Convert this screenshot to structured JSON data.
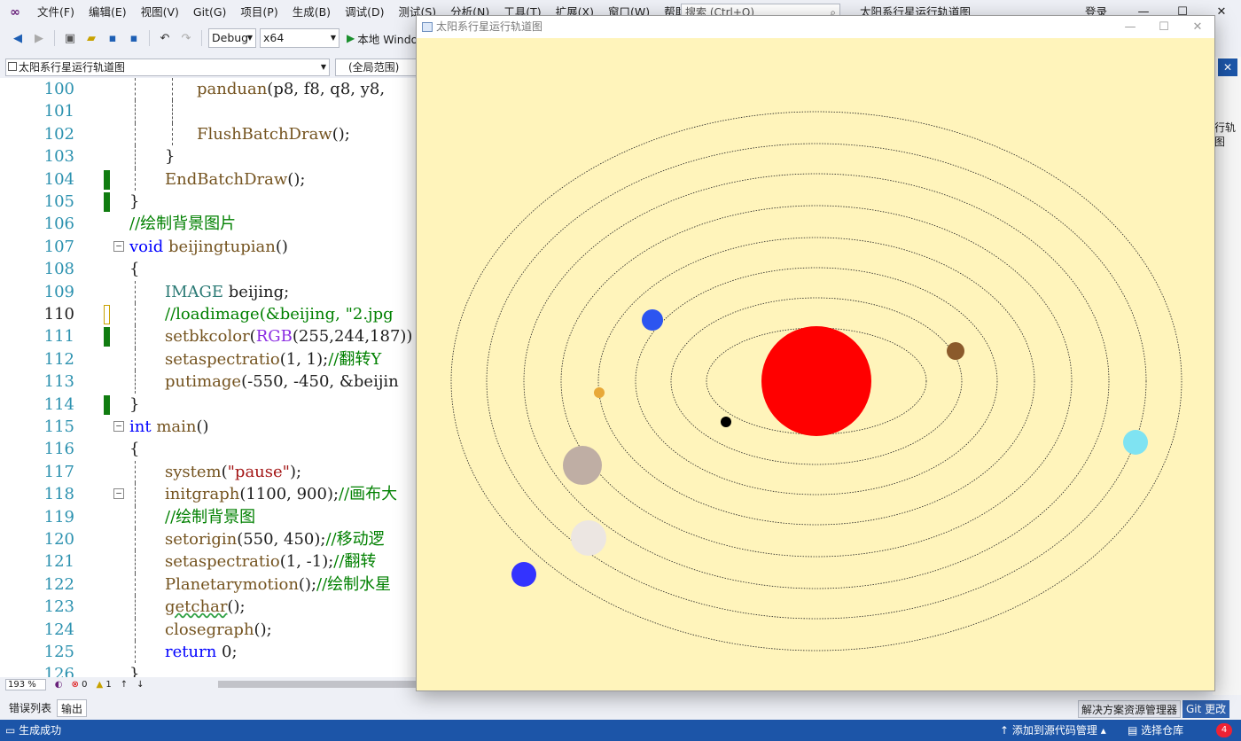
{
  "menubar": {
    "items": [
      "文件(F)",
      "编辑(E)",
      "视图(V)",
      "Git(G)",
      "项目(P)",
      "生成(B)",
      "调试(D)",
      "测试(S)",
      "分析(N)",
      "工具(T)",
      "扩展(X)",
      "窗口(W)",
      "帮助(H)"
    ],
    "search_placeholder": "搜索 (Ctrl+Q)",
    "solution_title": "太阳系行星运行轨道图",
    "login": "登录"
  },
  "toolbar": {
    "config": "Debug",
    "platform": "x64",
    "run_label": "本地 Windo"
  },
  "navbar": {
    "project": "太阳系行星运行轨道图",
    "scope": "(全局范围)"
  },
  "editor": {
    "lines": [
      {
        "n": "100",
        "text": "panduan(p8, f8, q8, y8,"
      },
      {
        "n": "101",
        "text": ""
      },
      {
        "n": "102",
        "text": "FlushBatchDraw();"
      },
      {
        "n": "103",
        "text": "}"
      },
      {
        "n": "104",
        "text": "EndBatchDraw();"
      },
      {
        "n": "105",
        "text": "}"
      },
      {
        "n": "106",
        "text": "//绘制背景图片"
      },
      {
        "n": "107",
        "text": "void beijingtupian()"
      },
      {
        "n": "108",
        "text": "{"
      },
      {
        "n": "109",
        "text": "IMAGE beijing;"
      },
      {
        "n": "110",
        "text": "//loadimage(&beijing, \"2.jpg"
      },
      {
        "n": "111",
        "text": "setbkcolor(RGB(255,244,187))"
      },
      {
        "n": "112",
        "text": "setaspectratio(1, 1);//翻转Y"
      },
      {
        "n": "113",
        "text": "putimage(-550, -450, &beijin"
      },
      {
        "n": "114",
        "text": "}"
      },
      {
        "n": "115",
        "text": "int main()"
      },
      {
        "n": "116",
        "text": "{"
      },
      {
        "n": "117",
        "text": "system(\"pause\");"
      },
      {
        "n": "118",
        "text": "initgraph(1100, 900);//画布大"
      },
      {
        "n": "119",
        "text": "//绘制背景图"
      },
      {
        "n": "120",
        "text": "setorigin(550, 450);//移动逻"
      },
      {
        "n": "121",
        "text": "setaspectratio(1, -1);//翻转"
      },
      {
        "n": "122",
        "text": "Planetarymotion();//绘制水星"
      },
      {
        "n": "123",
        "text": "getchar();"
      },
      {
        "n": "124",
        "text": "closegraph();"
      },
      {
        "n": "125",
        "text": "return 0;"
      },
      {
        "n": "126",
        "text": "}"
      }
    ]
  },
  "editor_status": {
    "zoom": "193 %",
    "errors": "0",
    "warnings": "1"
  },
  "bottom_tabs": {
    "error_list": "错误列表",
    "output": "输出",
    "solution_explorer": "解决方案资源管理器",
    "git_changes": "Git 更改"
  },
  "statusbar": {
    "build": "生成成功",
    "add_source": "添加到源代码管理",
    "select_repo": "选择仓库",
    "notifications": "4"
  },
  "right_panel": {
    "text": "行轨图"
  },
  "app_window": {
    "title": "太阳系行星运行轨道图",
    "background": "#fff4bb",
    "sun_color": "#ff0000",
    "orbit_count": 8,
    "planet_colors": [
      "#000000",
      "#8b5a2b",
      "#2c55f0",
      "#e8a838",
      "#bfaea4",
      "#ece6e2",
      "#3333ff",
      "#7fe3f2"
    ]
  }
}
